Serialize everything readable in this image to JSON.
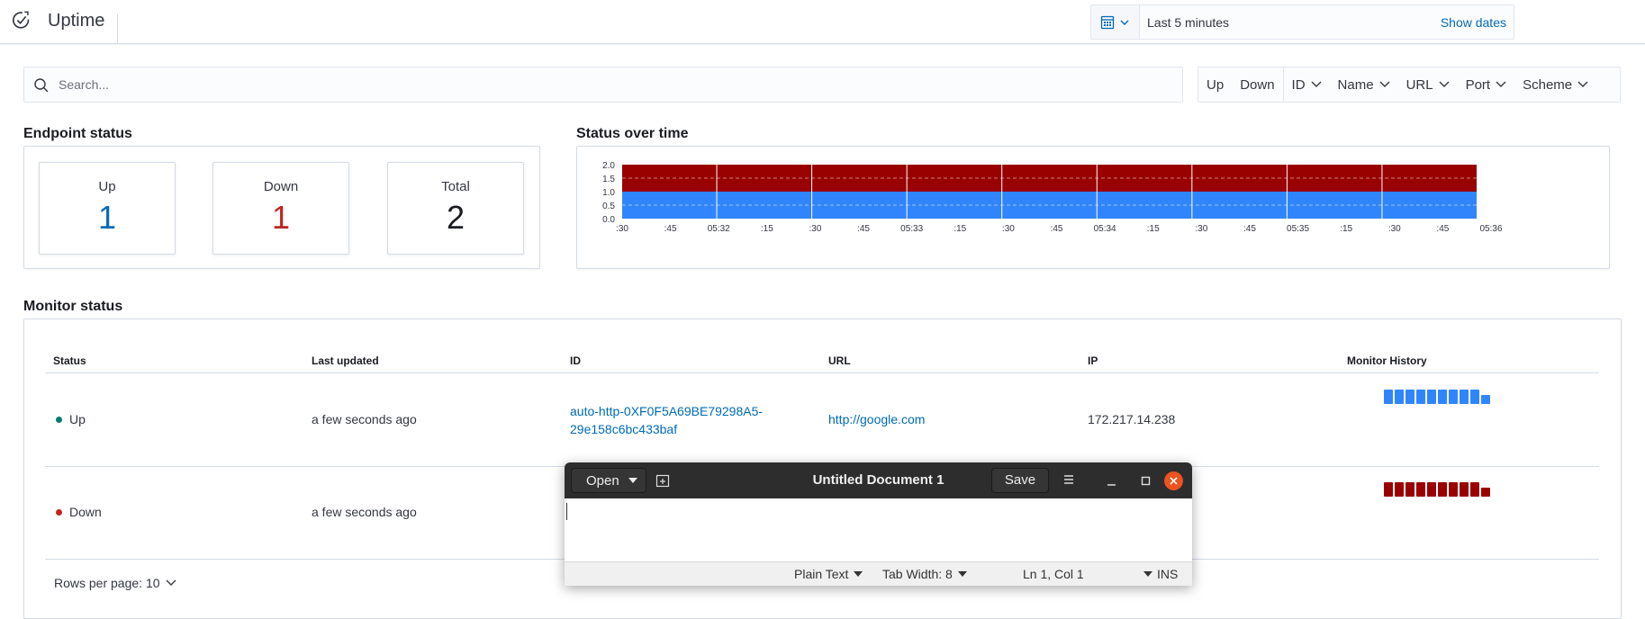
{
  "app": {
    "title": "Uptime"
  },
  "datepicker": {
    "icon": "calendar-icon",
    "range": "Last 5 minutes",
    "show_dates": "Show dates"
  },
  "search": {
    "placeholder": "Search..."
  },
  "filters": {
    "status": [
      "Up",
      "Down"
    ],
    "fields": [
      "ID",
      "Name",
      "URL",
      "Port",
      "Scheme"
    ]
  },
  "endpoint_status": {
    "title": "Endpoint status",
    "stats": [
      {
        "label": "Up",
        "value": "1",
        "color": "#006bb4"
      },
      {
        "label": "Down",
        "value": "1",
        "color": "#bd271e"
      },
      {
        "label": "Total",
        "value": "2",
        "color": "#1a1c21"
      }
    ]
  },
  "status_over_time": {
    "title": "Status over time"
  },
  "chart_data": {
    "type": "bar",
    "stacked": true,
    "x_ticks": [
      ":30",
      ":45",
      "05:32",
      ":15",
      ":30",
      ":45",
      "05:33",
      ":15",
      ":30",
      ":45",
      "05:34",
      ":15",
      ":30",
      ":45",
      "05:35",
      ":15",
      ":30",
      ":45",
      "05:36"
    ],
    "y_ticks": [
      "2.0",
      "1.5",
      "1.0",
      "0.5",
      "0.0"
    ],
    "ylim": [
      0,
      2
    ],
    "bucket_count": 9,
    "series": [
      {
        "values": [
          1,
          1,
          1,
          1,
          1,
          1,
          1,
          1,
          1
        ],
        "color": "#3185fc"
      },
      {
        "values": [
          1,
          1,
          1,
          1,
          1,
          1,
          1,
          1,
          1
        ],
        "color": "#990000"
      }
    ],
    "grid": true
  },
  "monitor_status": {
    "title": "Monitor status",
    "columns": [
      "Status",
      "Last updated",
      "ID",
      "URL",
      "IP",
      "Monitor History"
    ],
    "rows": [
      {
        "status": "Up",
        "status_color": "#017d73",
        "last_updated": "a few seconds ago",
        "id_line1": "auto-http-0XF0F5A69BE79298A5-",
        "id_line2": "29e158c6bc433baf",
        "url": "http://google.com",
        "ip": "172.217.14.238",
        "history_color": "#3185fc"
      },
      {
        "status": "Down",
        "status_color": "#bd271e",
        "last_updated": "a few seconds ago",
        "history_color": "#990000"
      }
    ],
    "rows_per_page": "Rows per page: 10"
  },
  "gedit": {
    "open_label": "Open",
    "title": "Untitled Document 1",
    "save_label": "Save",
    "status": {
      "language": "Plain Text",
      "tab_width": "Tab Width: 8",
      "position": "Ln 1, Col 1",
      "mode": "INS"
    }
  }
}
